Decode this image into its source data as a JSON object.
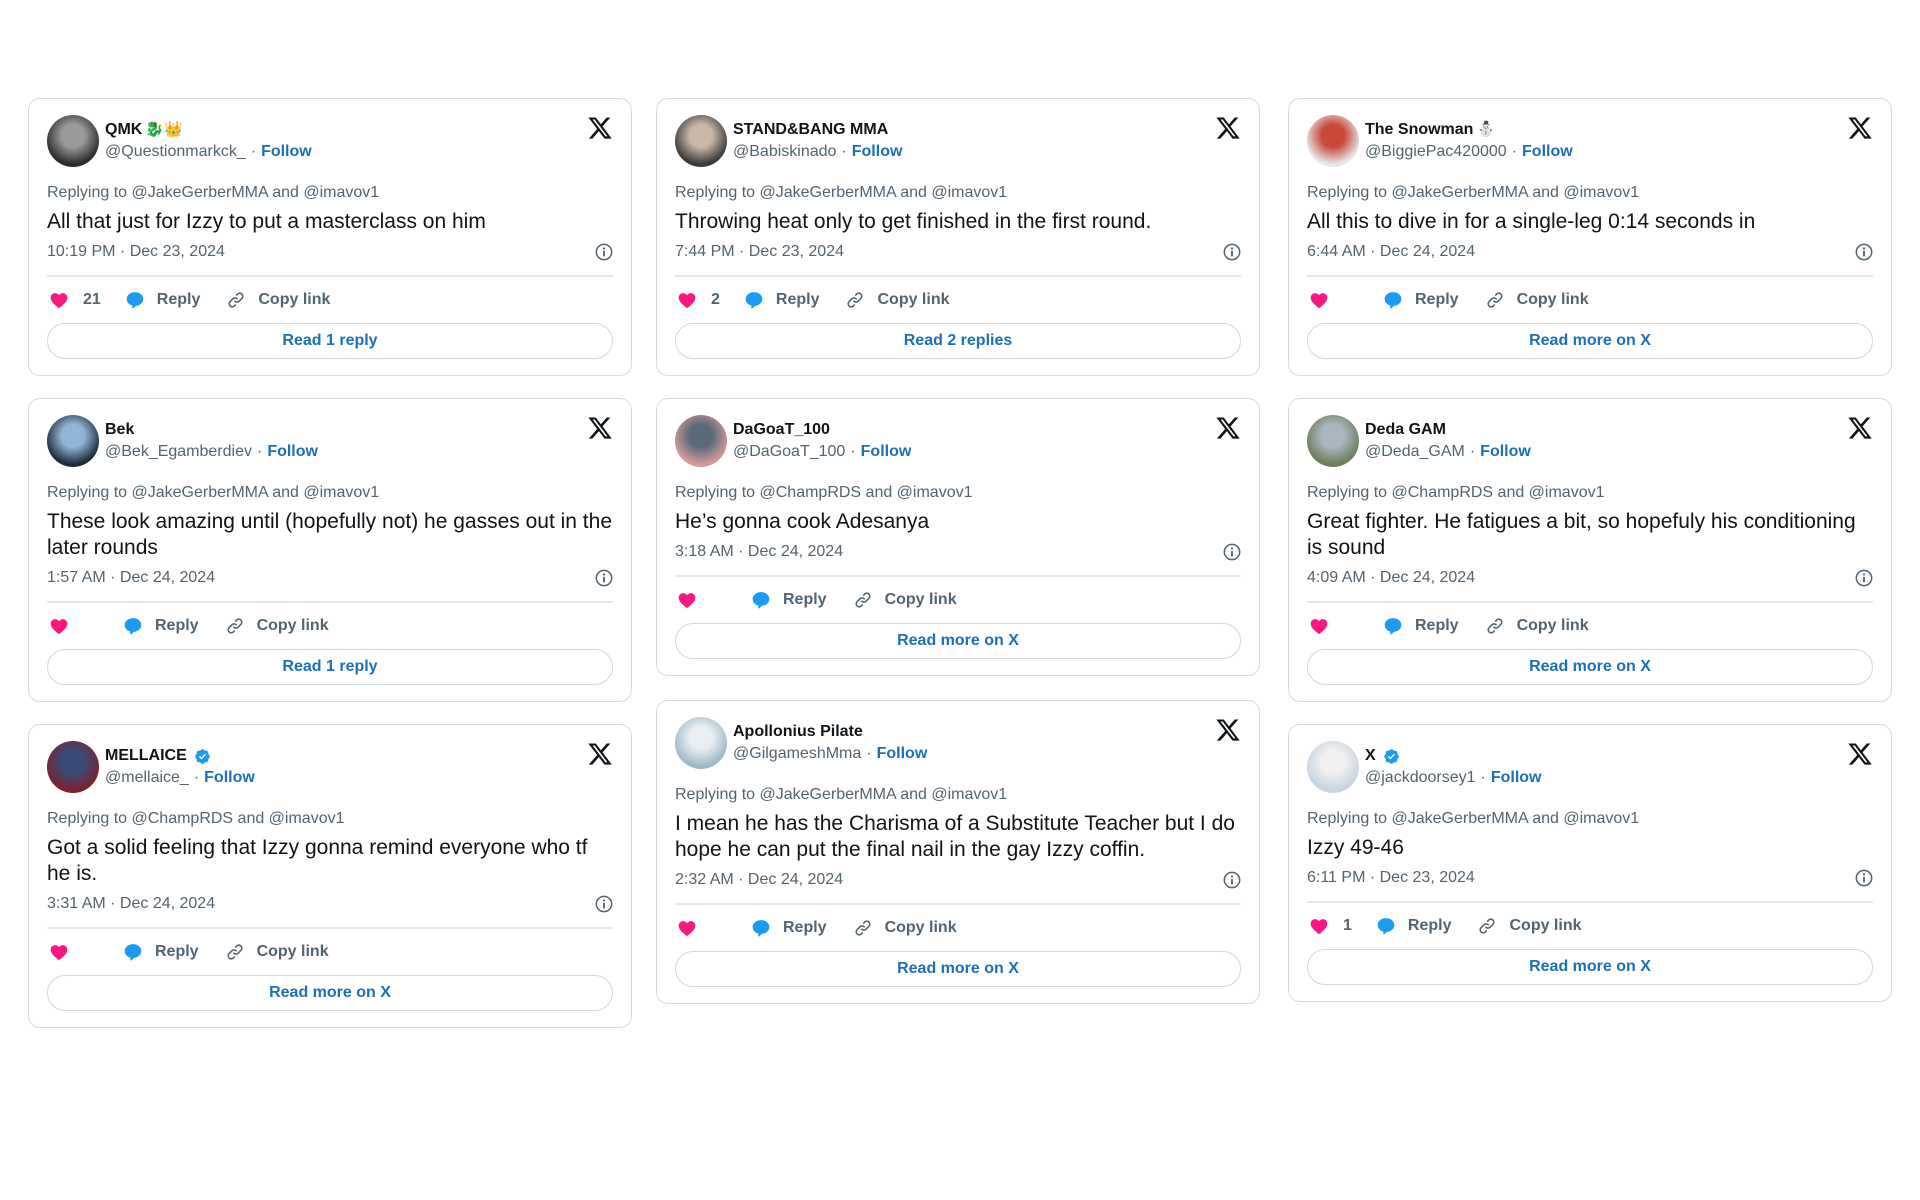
{
  "colors": {
    "like": "#f91880",
    "reply": "#1d9bf0",
    "link": "#1d6fb8",
    "muted": "#536471",
    "text": "#0f1419",
    "border": "#d9dcdf"
  },
  "icons": {
    "like": "heart-icon",
    "reply": "speech-bubble-icon",
    "copy": "link-icon",
    "info": "info-icon",
    "brand": "x-logo-icon",
    "verified": "verified-badge-icon"
  },
  "labels": {
    "follow": "Follow",
    "reply": "Reply",
    "copy_link": "Copy link",
    "separator": "·"
  },
  "columns": [
    {
      "tweets": [
        {
          "name": "QMK",
          "name_emoji": "🐉👑",
          "verified": false,
          "handle": "@Questionmarkck_",
          "replying": "Replying to @JakeGerberMMA and @imavov1",
          "text": "All that just for Izzy to put a masterclass on him",
          "timestamp": "10:19 PM · Dec 23, 2024",
          "likes": "21",
          "button": "Read 1 reply",
          "avatar_colors": [
            "#2b2b2b",
            "#9a9a9a"
          ]
        },
        {
          "name": "Bek",
          "name_emoji": "",
          "verified": false,
          "handle": "@Bek_Egamberdiev",
          "replying": "Replying to @JakeGerberMMA and @imavov1",
          "text": "These look amazing until (hopefully not) he gasses out in the later rounds",
          "timestamp": "1:57 AM · Dec 24, 2024",
          "likes": "",
          "button": "Read 1 reply",
          "avatar_colors": [
            "#1e2a3a",
            "#8fb6d6"
          ]
        },
        {
          "name": "MELLAICE",
          "name_emoji": "",
          "verified": true,
          "handle": "@mellaice_",
          "replying": "Replying to @ChampRDS and @imavov1",
          "text": "Got a solid feeling that Izzy gonna remind everyone who tf he is.",
          "timestamp": "3:31 AM · Dec 24, 2024",
          "likes": "",
          "button": "Read more on X",
          "avatar_colors": [
            "#7a2230",
            "#3a4a78"
          ]
        }
      ]
    },
    {
      "tweets": [
        {
          "name": "STAND&BANG MMA",
          "name_emoji": "",
          "verified": false,
          "handle": "@Babiskinado",
          "replying": "Replying to @JakeGerberMMA and @imavov1",
          "text": "Throwing heat only to get finished in the first round.",
          "timestamp": "7:44 PM · Dec 23, 2024",
          "likes": "2",
          "button": "Read 2 replies",
          "avatar_colors": [
            "#3a3a3a",
            "#c9b7a8"
          ]
        },
        {
          "name": "DaGoaT_100",
          "name_emoji": "",
          "verified": false,
          "handle": "@DaGoaT_100",
          "replying": "Replying to @ChampRDS and @imavov1",
          "text": "He’s gonna cook Adesanya",
          "timestamp": "3:18 AM · Dec 24, 2024",
          "likes": "",
          "button": "Read more on X",
          "avatar_colors": [
            "#d49a9a",
            "#5a6a7a"
          ]
        },
        {
          "name": "Apollonius Pilate",
          "name_emoji": "",
          "verified": false,
          "handle": "@GilgameshMma",
          "replying": "Replying to @JakeGerberMMA and @imavov1",
          "text": "I mean he has the Charisma of a Substitute Teacher but I do hope he can put the final nail in the gay Izzy coffin.",
          "timestamp": "2:32 AM · Dec 24, 2024",
          "likes": "",
          "button": "Read more on X",
          "avatar_colors": [
            "#9fb8c8",
            "#e8eef2"
          ]
        }
      ]
    },
    {
      "tweets": [
        {
          "name": "The Snowman",
          "name_emoji": "⛄",
          "verified": false,
          "handle": "@BiggiePac420000",
          "replying": "Replying to @JakeGerberMMA and @imavov1",
          "text": "All this to dive in for a single-leg 0:14 seconds in",
          "timestamp": "6:44 AM · Dec 24, 2024",
          "likes": "",
          "button": "Read more on X",
          "avatar_colors": [
            "#e8e8e8",
            "#c94a3a"
          ]
        },
        {
          "name": "Deda GAM",
          "name_emoji": "",
          "verified": false,
          "handle": "@Deda_GAM",
          "replying": "Replying to @ChampRDS and @imavov1",
          "text": "Great fighter. He fatigues a bit, so hopefuly his conditioning is sound",
          "timestamp": "4:09 AM · Dec 24, 2024",
          "likes": "",
          "button": "Read more on X",
          "avatar_colors": [
            "#6f7e5a",
            "#a9b6bf"
          ]
        },
        {
          "name": "X",
          "name_emoji": "",
          "verified": true,
          "handle": "@jackdoorsey1",
          "replying": "Replying to @JakeGerberMMA and @imavov1",
          "text": "Izzy 49-46",
          "timestamp": "6:11 PM · Dec 23, 2024",
          "likes": "1",
          "button": "Read more on X",
          "avatar_colors": [
            "#c8d4e0",
            "#f0f0f0"
          ]
        }
      ]
    }
  ]
}
